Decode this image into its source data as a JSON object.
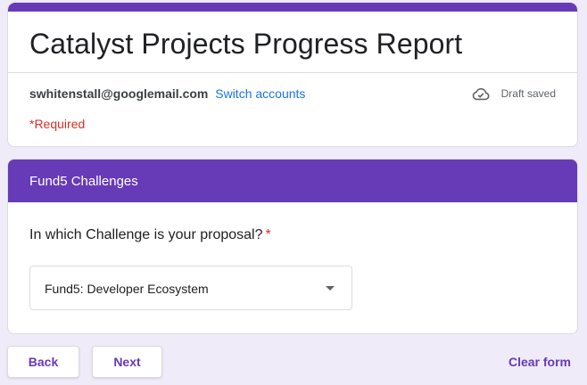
{
  "form": {
    "title": "Catalyst Projects Progress Report",
    "account_email": "swhitenstall@googlemail.com",
    "switch_accounts_label": "Switch accounts",
    "draft_status": "Draft saved",
    "required_note": "*Required"
  },
  "section": {
    "title": "Fund5 Challenges",
    "question": "In which Challenge is your proposal?",
    "required_marker": "*",
    "dropdown_value": "Fund5: Developer Ecosystem"
  },
  "footer": {
    "back_label": "Back",
    "next_label": "Next",
    "clear_label": "Clear form"
  },
  "colors": {
    "accent": "#673ab7",
    "link": "#1a73e8",
    "required": "#d93025",
    "background": "#efebf8"
  },
  "icons": {
    "draft": "cloud-check-icon",
    "dropdown": "arrow-drop-down-icon"
  }
}
